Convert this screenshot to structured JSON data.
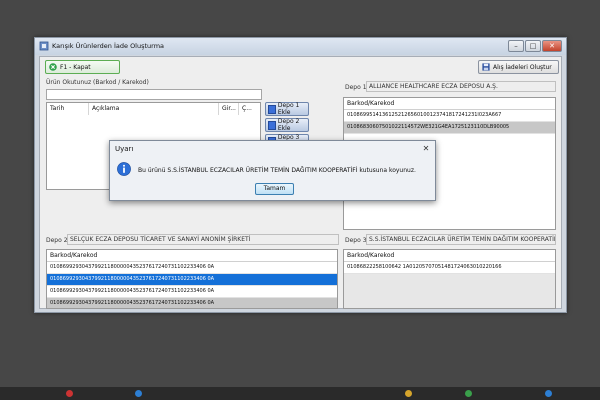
{
  "window": {
    "title": "Karışık Ürünlerden İade Oluşturma",
    "minimize": "–",
    "maximize": "□",
    "close": "✕"
  },
  "toolbar": {
    "close_btn": "F1 - Kapat",
    "create_btn": "Alış İadeleri Oluştur"
  },
  "scan": {
    "label": "Ürün Okutunuz (Barkod / Karekod)",
    "value": ""
  },
  "history": {
    "columns": [
      "Tarih",
      "Açıklama",
      "Gir...",
      "Ç..."
    ]
  },
  "depot_buttons": [
    "Depo 1  Ekle",
    "Depo 2 Ekle",
    "Depo 3 Ekle"
  ],
  "depo1": {
    "label": "Depo 1",
    "name": "ALLIANCE HEALTHCARE ECZA DEPOSU A.Ş.",
    "header": "Barkod/Karekod",
    "rows": [
      "01086995141361252126560100123741817241231l023A667",
      "01086830607501022114572WE321G4EA1725123110DLB90005"
    ]
  },
  "depo2": {
    "label": "Depo 2",
    "name": "SELÇUK ECZA DEPOSU TİCARET VE SANAYİ ANONİM ŞİRKETİ",
    "header": "Barkod/Karekod",
    "rows": [
      "0108699293043799211800000435237617240731102233406 0A",
      "0108699293043799211800000435237617240731102233406 0A",
      "0108699293043799211800000435237617240731102233406 0A",
      "0108699293043799211800000435237617240731102233406 0A"
    ]
  },
  "depo3": {
    "label": "Depo 3",
    "name": "S.S.İSTANBUL ECZACILAR ÜRETİM TEMİN DAĞITIM KOOPERATİFİ",
    "header": "Barkod/Karekod",
    "rows": [
      "01086822258100642 1A01205707051481724063010220166"
    ]
  },
  "dialog": {
    "title": "Uyarı",
    "close": "✕",
    "message": "Bu ürünü S.S.İSTANBUL ECZACILAR ÜRETİM TEMİN DAĞITIM KOOPERATİFİ kutusuna koyunuz.",
    "ok": "Tamam"
  },
  "colors": {
    "selection": "#1470d8",
    "desktop": "#474747",
    "dialog_icon": "#2d6fd6"
  }
}
